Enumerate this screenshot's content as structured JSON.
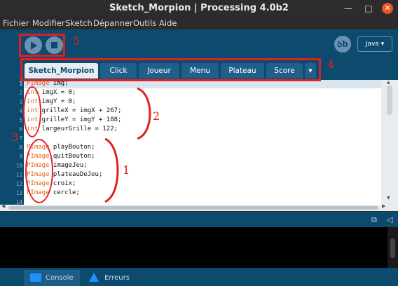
{
  "window": {
    "title": "Sketch_Morpion | Processing 4.0b2",
    "minimize_symbol": "—",
    "maximize_symbol": "□",
    "close_symbol": "✕"
  },
  "menu": [
    "Fichier",
    "Modifier",
    "Sketch",
    "Dépanner",
    "Outils",
    "Aide"
  ],
  "toolbar": {
    "run_icon": "play-icon",
    "stop_icon": "stop-icon",
    "mode_icon_label": "ꝺb",
    "mode_label": "Java ▾"
  },
  "tabs": [
    "Sketch_Morpion",
    "Click",
    "Joueur",
    "Menu",
    "Plateau",
    "Score"
  ],
  "tab_overflow": "▾",
  "active_tab": 0,
  "code_lines": [
    {
      "n": "1",
      "kw": "PImage",
      "rest": " img;"
    },
    {
      "n": "2",
      "kw": "int",
      "rest": " imgX = 0;"
    },
    {
      "n": "3",
      "kw": "int",
      "rest": " imgY = 0;"
    },
    {
      "n": "4",
      "kw": "int",
      "rest": " grilleX = imgX + 267;"
    },
    {
      "n": "5",
      "kw": "int",
      "rest": " grilleY = imgY + 188;"
    },
    {
      "n": "6",
      "kw": "int",
      "rest": " largeurGrille = 122;"
    },
    {
      "n": "7",
      "kw": "",
      "rest": ""
    },
    {
      "n": "8",
      "kw": "PImage",
      "rest": " playBouton;"
    },
    {
      "n": "9",
      "kw": "PImage",
      "rest": " quitBouton;"
    },
    {
      "n": "10",
      "kw": "PImage",
      "rest": " imageJeu;"
    },
    {
      "n": "11",
      "kw": "PImage",
      "rest": " plateauDeJeu;"
    },
    {
      "n": "12",
      "kw": "PImage",
      "rest": " croix;"
    },
    {
      "n": "13",
      "kw": "PImage",
      "rest": " cercle;"
    },
    {
      "n": "14",
      "kw": "",
      "rest": ""
    }
  ],
  "bottom_tabs": {
    "console": "Console",
    "errors": "Erreurs"
  },
  "annotations": {
    "n1": "1",
    "n2": "2",
    "n3": "3",
    "n4": "4",
    "n5": "5",
    "color": "#e02020"
  },
  "colors": {
    "toolbar": "#0c4a6e",
    "keyword": "#e2661a",
    "close_button": "#e95420"
  }
}
